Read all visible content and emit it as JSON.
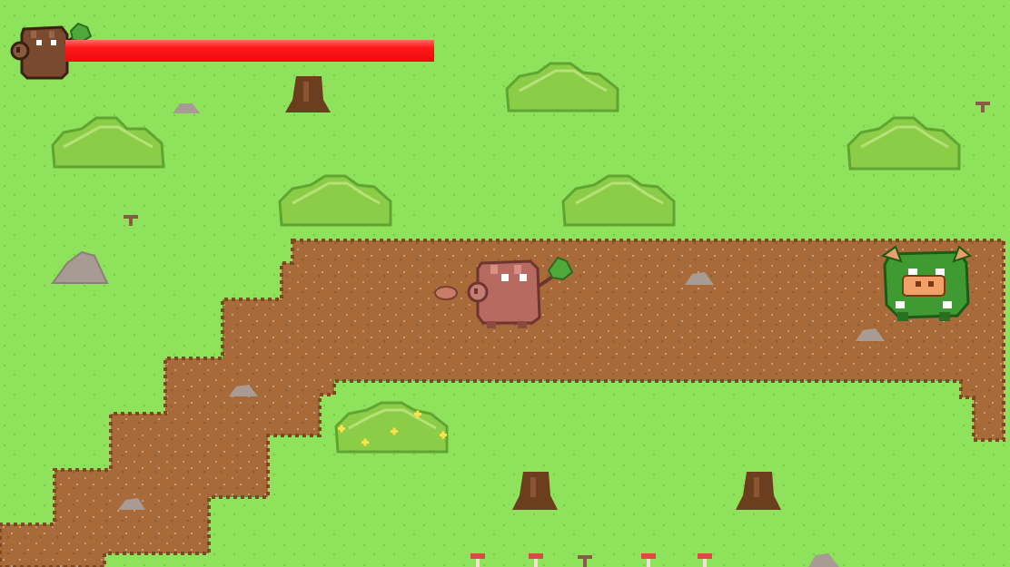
{
  "game": {
    "hud": {
      "player_portrait_icon": "brown-stump-creature-icon",
      "health_fraction": 1.0,
      "health_color": "#ff1a1a"
    },
    "player": {
      "name_icon": "wooden-stump-with-leaf-sprout"
    },
    "projectile": {
      "icon": "seed-projectile"
    },
    "enemy": {
      "icon": "green-boar-enemy"
    },
    "colors": {
      "grass": "#8fe35c",
      "path": "#a86a38",
      "bush": "#8ccd48",
      "stump": "#6b3e1e",
      "rock": "#a89b94"
    }
  }
}
